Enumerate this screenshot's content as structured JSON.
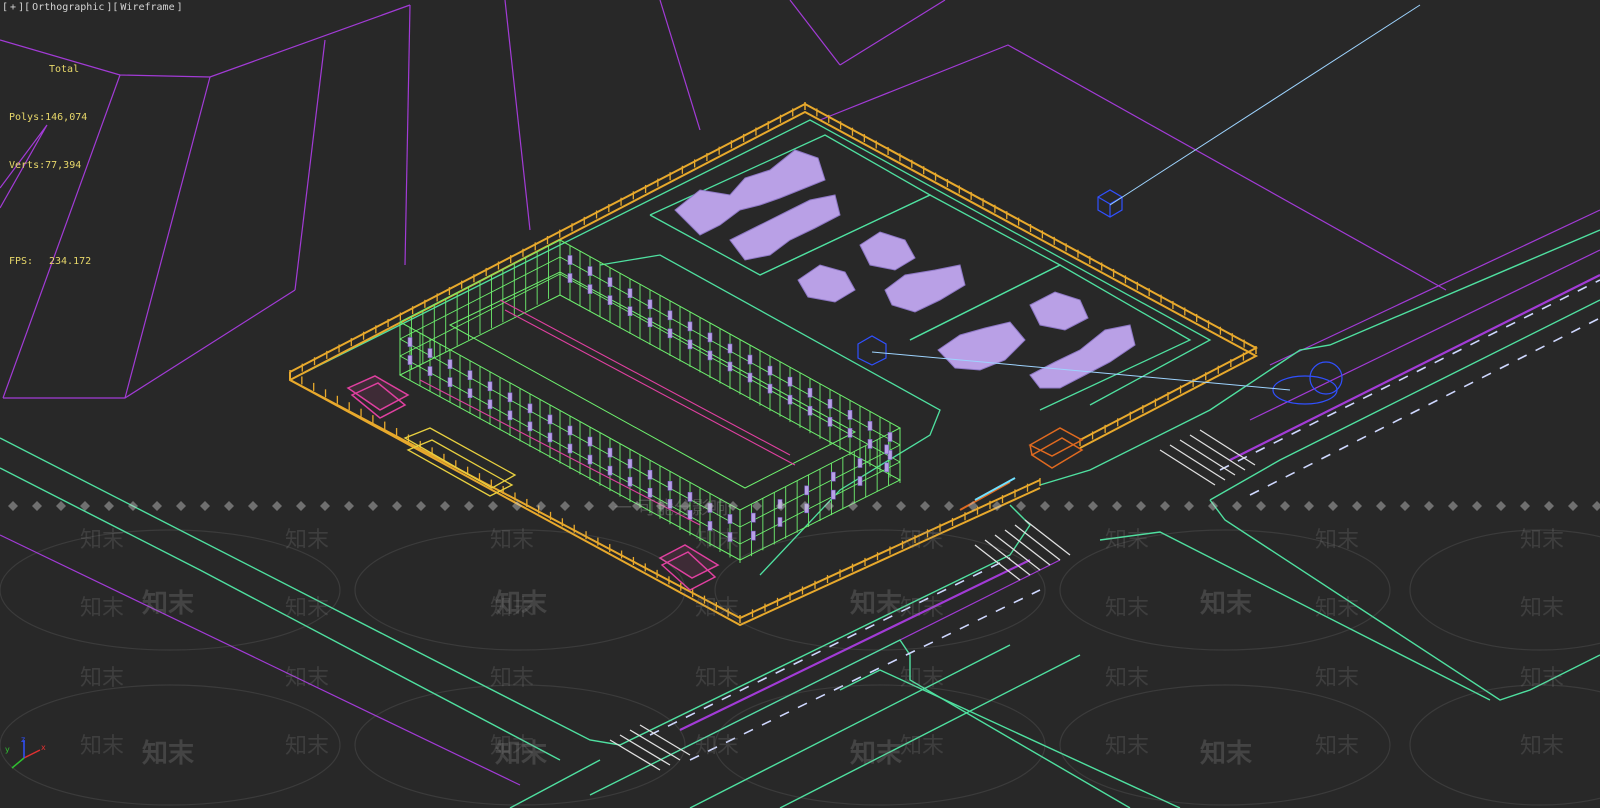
{
  "viewport": {
    "label_parts": [
      "[",
      "+",
      "][",
      "Orthographic",
      "][",
      "Wireframe",
      "]"
    ],
    "mode": "Orthographic",
    "shading": "Wireframe"
  },
  "stats": {
    "header": "Total",
    "polys_label": "Polys:",
    "polys_value": "146,074",
    "verts_label": "Verts:",
    "verts_value": "77,394",
    "fps_label": "FPS:",
    "fps_value": "234.172"
  },
  "axis": {
    "x": "x",
    "y": "y",
    "z": "z"
  },
  "watermark": {
    "small": "知末",
    "partial": "一             可能分影响"
  },
  "colors": {
    "background": "#282828",
    "building_wire": "#6ef06e",
    "fence": "#e8a92c",
    "trees": "#b9a0e6",
    "road_edge": "#4fe0a0",
    "terrain": "#a23bd6",
    "pink_objects": "#e040a0",
    "helper": "#3050ff"
  }
}
